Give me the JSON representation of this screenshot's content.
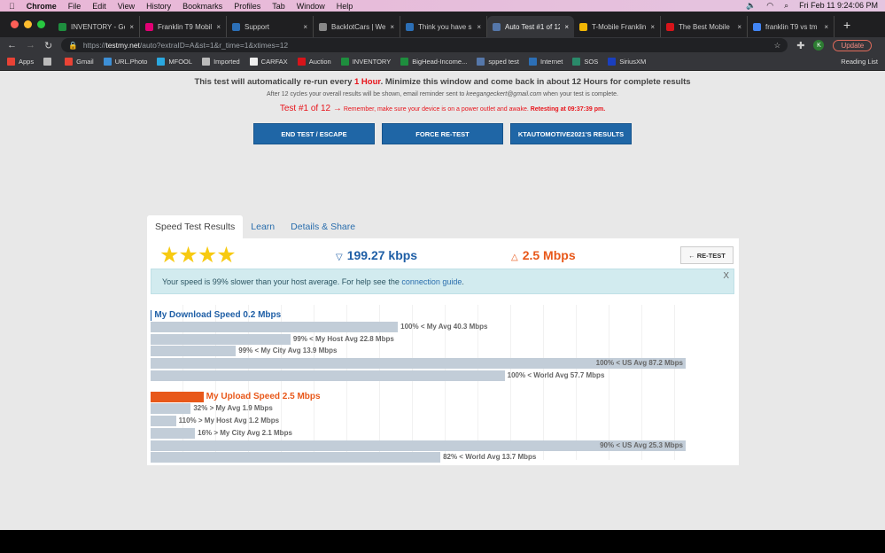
{
  "menubar": {
    "app": "Chrome",
    "items": [
      "File",
      "Edit",
      "View",
      "History",
      "Bookmarks",
      "Profiles",
      "Tab",
      "Window",
      "Help"
    ],
    "clock": "Fri Feb 11  9:24:06 PM"
  },
  "tabs": [
    {
      "label": "INVENTORY - Go",
      "color": "#1e8e3e"
    },
    {
      "label": "Franklin T9 Mobil",
      "color": "#e20074"
    },
    {
      "label": "Support",
      "color": "#2c6fb6"
    },
    {
      "label": "BacklotCars | We",
      "color": "#888888"
    },
    {
      "label": "Think you have sl",
      "color": "#2c6fb6"
    },
    {
      "label": "Auto Test #1 of 12",
      "color": "#5577aa",
      "active": true
    },
    {
      "label": "T-Mobile Franklin",
      "color": "#f2b705"
    },
    {
      "label": "The Best Mobile",
      "color": "#d7141a"
    },
    {
      "label": "franklin T9 vs tm",
      "color": "#4285f4"
    }
  ],
  "address": {
    "scheme": "https://",
    "host": "testmy.net",
    "path": "/auto?extraID=A&st=1&r_time=1&xtimes=12",
    "avatar": "K",
    "update": "Update"
  },
  "bookmarks": [
    {
      "label": "Apps",
      "color": "#e94235"
    },
    {
      "label": "",
      "color": "#bbbbbb"
    },
    {
      "label": "Gmail",
      "color": "#ea4335"
    },
    {
      "label": "URL.Photo",
      "color": "#3d8fd6"
    },
    {
      "label": "MFOOL",
      "color": "#2aa8e0"
    },
    {
      "label": "Imported",
      "color": "#bbbbbb"
    },
    {
      "label": "CARFAX",
      "color": "#eeeeee"
    },
    {
      "label": "Auction",
      "color": "#d7141a"
    },
    {
      "label": "INVENTORY",
      "color": "#1e8e3e"
    },
    {
      "label": "BigHead-Income...",
      "color": "#1e8e3e"
    },
    {
      "label": "spped test",
      "color": "#5577aa"
    },
    {
      "label": "Internet",
      "color": "#2c6fb6"
    },
    {
      "label": "SOS",
      "color": "#2a8a6a"
    },
    {
      "label": "SiriusXM",
      "color": "#1a3fbf"
    }
  ],
  "reading_list": "Reading List",
  "notice": {
    "pre": "This test will automatically re-run every ",
    "hour": "1 Hour",
    "post": ".  Minimize this window and come back in about 12 Hours for complete results",
    "line2_pre": "After 12 cycles your overall results will be shown, email reminder sent to ",
    "email": "keegangeckert@gmail.com",
    "line2_post": " when your test is complete.",
    "test_no": "Test #1 of 12 →",
    "reminder": " Remember, make sure your device is on a power outlet and awake. ",
    "retesting": "Retesting at 09:37:39 pm."
  },
  "buttons": {
    "end": "END TEST / ESCAPE",
    "force": "FORCE RE-TEST",
    "results": "KTAUTOMOTIVE2021'S RESULTS"
  },
  "result_tabs": [
    "Speed Test Results",
    "Learn",
    "Details & Share"
  ],
  "results": {
    "stars": 4,
    "stars_text": "★★★★",
    "download": "199.27 kbps",
    "upload": "2.5 Mbps",
    "retest": "← RE-TEST",
    "download_color": "#1f5fa6",
    "upload_color": "#e8581a"
  },
  "alert": {
    "text": "Your speed is 99% slower than your host average. For help see the ",
    "link": "connection guide",
    "end": ".",
    "close": "X"
  },
  "chart_data": [
    {
      "type": "bar",
      "title": "My Download Speed 0.2 Mbps",
      "value": 0.2,
      "categories": [
        "My Avg",
        "My Host Avg",
        "My City Avg",
        "US Avg",
        "World Avg"
      ],
      "values": [
        40.3,
        22.8,
        13.9,
        87.2,
        57.7
      ],
      "labels": [
        "100% < My Avg 40.3 Mbps",
        "99% < My Host Avg 22.8 Mbps",
        "99% < My City Avg 13.9 Mbps",
        "100% < US Avg 87.2 Mbps",
        "100% < World Avg 57.7 Mbps"
      ]
    },
    {
      "type": "bar",
      "title": "My Upload Speed 2.5 Mbps",
      "value": 2.5,
      "categories": [
        "My Avg",
        "My Host Avg",
        "My City Avg",
        "US Avg",
        "World Avg"
      ],
      "values": [
        1.9,
        1.2,
        2.1,
        25.3,
        13.7
      ],
      "labels": [
        "32% > My Avg 1.9 Mbps",
        "110% > My Host Avg 1.2 Mbps",
        "16% > My City Avg 2.1 Mbps",
        "90% < US Avg 25.3 Mbps",
        "82% < World Avg 13.7 Mbps"
      ]
    }
  ]
}
